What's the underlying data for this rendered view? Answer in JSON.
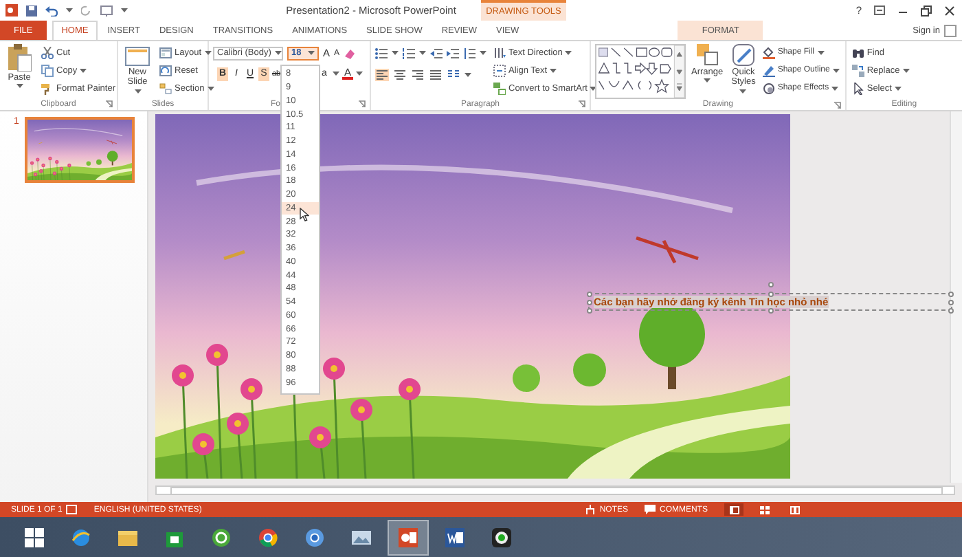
{
  "window": {
    "title": "Presentation2 - Microsoft PowerPoint",
    "context_group": "DRAWING TOOLS",
    "help": "?",
    "sign_in": "Sign in"
  },
  "tabs": [
    {
      "label": "FILE",
      "kind": "file",
      "selected": false
    },
    {
      "label": "HOME",
      "kind": "tab",
      "selected": true
    },
    {
      "label": "INSERT",
      "kind": "tab",
      "selected": false
    },
    {
      "label": "DESIGN",
      "kind": "tab",
      "selected": false
    },
    {
      "label": "TRANSITIONS",
      "kind": "tab",
      "selected": false
    },
    {
      "label": "ANIMATIONS",
      "kind": "tab",
      "selected": false
    },
    {
      "label": "SLIDE SHOW",
      "kind": "tab",
      "selected": false
    },
    {
      "label": "REVIEW",
      "kind": "tab",
      "selected": false
    },
    {
      "label": "VIEW",
      "kind": "tab",
      "selected": false
    },
    {
      "label": "FORMAT",
      "kind": "context",
      "selected": false
    }
  ],
  "ribbon": {
    "clipboard": {
      "label": "Clipboard",
      "paste": "Paste",
      "commands": [
        "Cut",
        "Copy",
        "Format Painter"
      ]
    },
    "slides": {
      "label": "Slides",
      "new_slide": "New Slide",
      "commands": [
        "Layout",
        "Reset",
        "Section"
      ]
    },
    "font": {
      "label": "Fo",
      "font_name": "Calibri (Body)",
      "font_size": "18",
      "grow": "A",
      "shrink": "A",
      "case": "a",
      "font_color": "A",
      "formats": [
        {
          "label": "B",
          "on": true
        },
        {
          "label": "I",
          "on": false
        },
        {
          "label": "U",
          "on": false
        },
        {
          "label": "S",
          "on": true
        },
        {
          "label": "ab",
          "on": false
        }
      ]
    },
    "paragraph": {
      "label": "Paragraph",
      "commands": [
        "Text Direction",
        "Align Text",
        "Convert to SmartArt"
      ]
    },
    "drawing": {
      "label": "Drawing",
      "arrange": "Arrange",
      "quick_styles": "Quick Styles",
      "commands": [
        "Shape Fill",
        "Shape Outline",
        "Shape Effects"
      ]
    },
    "editing": {
      "label": "Editing",
      "commands": [
        "Find",
        "Replace",
        "Select"
      ]
    }
  },
  "font_size_list": {
    "items": [
      {
        "label": "8",
        "selected": false
      },
      {
        "label": "9",
        "selected": false
      },
      {
        "label": "10",
        "selected": false
      },
      {
        "label": "10.5",
        "selected": false
      },
      {
        "label": "11",
        "selected": false
      },
      {
        "label": "12",
        "selected": false
      },
      {
        "label": "14",
        "selected": false
      },
      {
        "label": "16",
        "selected": false
      },
      {
        "label": "18",
        "selected": false
      },
      {
        "label": "20",
        "selected": false
      },
      {
        "label": "24",
        "selected": true
      },
      {
        "label": "28",
        "selected": false
      },
      {
        "label": "32",
        "selected": false
      },
      {
        "label": "36",
        "selected": false
      },
      {
        "label": "40",
        "selected": false
      },
      {
        "label": "44",
        "selected": false
      },
      {
        "label": "48",
        "selected": false
      },
      {
        "label": "54",
        "selected": false
      },
      {
        "label": "60",
        "selected": false
      },
      {
        "label": "66",
        "selected": false
      },
      {
        "label": "72",
        "selected": false
      },
      {
        "label": "80",
        "selected": false
      },
      {
        "label": "88",
        "selected": false
      },
      {
        "label": "96",
        "selected": false
      }
    ]
  },
  "slides_panel": {
    "thumbnails": [
      {
        "number": "1",
        "selected": true
      }
    ]
  },
  "slide": {
    "text_box": {
      "text": "Các bạn hãy nhớ đăng ký kênh Tin học nhỏ nhé",
      "selected": true
    }
  },
  "status_bar": {
    "slide": "SLIDE 1 OF 1",
    "language": "ENGLISH (UNITED STATES)",
    "notes": "NOTES",
    "comments": "COMMENTS"
  },
  "taskbar": {
    "apps": [
      {
        "selected": false
      },
      {
        "selected": false
      },
      {
        "selected": false
      },
      {
        "selected": false
      },
      {
        "selected": false
      },
      {
        "selected": false
      },
      {
        "selected": false
      },
      {
        "selected": false
      },
      {
        "selected": true
      },
      {
        "selected": false
      },
      {
        "selected": false
      }
    ]
  }
}
